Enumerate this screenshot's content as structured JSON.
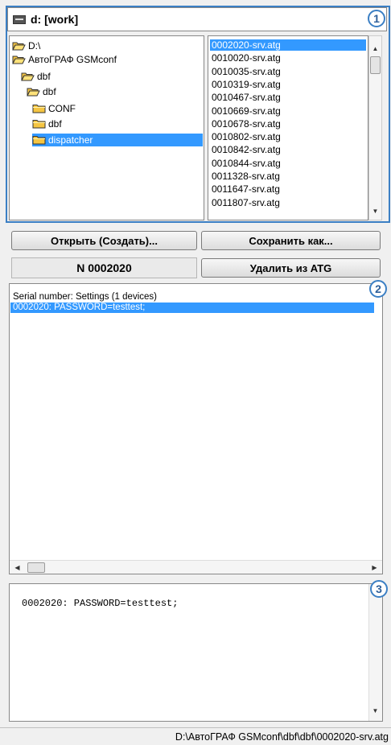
{
  "drive": {
    "icon": "drive-icon",
    "label": "d: [work]"
  },
  "badges": [
    "1",
    "2",
    "3"
  ],
  "tree": {
    "items": [
      {
        "label": "D:\\",
        "icon": "folder-open-icon",
        "selected": false
      },
      {
        "label": "АвтоГРАФ GSMconf",
        "icon": "folder-open-icon",
        "selected": false
      },
      {
        "label": "dbf",
        "icon": "folder-open-icon",
        "selected": false
      },
      {
        "label": "dbf",
        "icon": "folder-open-icon",
        "selected": false
      },
      {
        "label": "CONF",
        "icon": "folder-closed-icon",
        "selected": false
      },
      {
        "label": "dbf",
        "icon": "folder-closed-icon",
        "selected": false
      },
      {
        "label": "dispatcher",
        "icon": "folder-closed-icon",
        "selected": true
      }
    ]
  },
  "files": {
    "items": [
      {
        "name": "0002020-srv.atg",
        "selected": true
      },
      {
        "name": "0010020-srv.atg",
        "selected": false
      },
      {
        "name": "0010035-srv.atg",
        "selected": false
      },
      {
        "name": "0010319-srv.atg",
        "selected": false
      },
      {
        "name": "0010467-srv.atg",
        "selected": false
      },
      {
        "name": "0010669-srv.atg",
        "selected": false
      },
      {
        "name": "0010678-srv.atg",
        "selected": false
      },
      {
        "name": "0010802-srv.atg",
        "selected": false
      },
      {
        "name": "0010842-srv.atg",
        "selected": false
      },
      {
        "name": "0010844-srv.atg",
        "selected": false
      },
      {
        "name": "0011328-srv.atg",
        "selected": false
      },
      {
        "name": "0011647-srv.atg",
        "selected": false
      },
      {
        "name": "0011807-srv.atg",
        "selected": false
      }
    ]
  },
  "buttons": {
    "open_label": "Открыть (Создать)...",
    "save_as_label": "Сохранить как...",
    "delete_label": "Удалить из ATG"
  },
  "serial_display": "N 0002020",
  "settings": {
    "header": "Serial number: Settings (1 devices)",
    "selected_line": "0002020: PASSWORD=testtest;"
  },
  "editor": {
    "text": "0002020: PASSWORD=testtest;"
  },
  "status": {
    "path": "D:\\АвтоГРАФ GSMconf\\dbf\\dbf\\0002020-srv.atg"
  },
  "colors": {
    "selection": "#3399ff",
    "frame": "#3b7fc4",
    "folder": "#f5c542"
  }
}
